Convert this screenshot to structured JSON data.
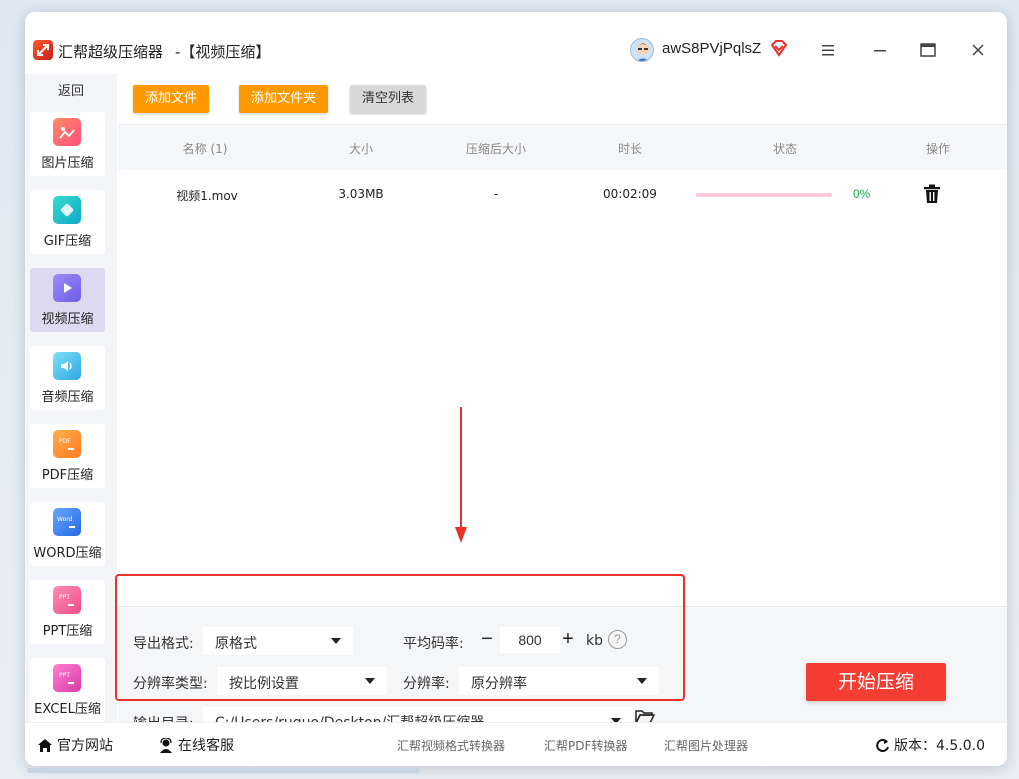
{
  "app": {
    "title": "汇帮超级压缩器",
    "page_tag": "-【视频压缩】",
    "username": "awS8PVjPqlsZ"
  },
  "sidebar": {
    "back_label": "返回",
    "items": [
      {
        "label": "图片压缩",
        "icon": "image-compress-icon",
        "color": "#ff5f78"
      },
      {
        "label": "GIF压缩",
        "icon": "gif-compress-icon",
        "color": "#17c3c9"
      },
      {
        "label": "视频压缩",
        "icon": "video-compress-icon",
        "color": "#7c6ef2",
        "active": true
      },
      {
        "label": "音频压缩",
        "icon": "audio-compress-icon",
        "color": "#3ec6e8"
      },
      {
        "label": "PDF压缩",
        "icon": "pdf-compress-icon",
        "color": "#ff8c2a"
      },
      {
        "label": "WORD压缩",
        "icon": "word-compress-icon",
        "color": "#2f7de8"
      },
      {
        "label": "PPT压缩",
        "icon": "ppt-compress-icon",
        "color": "#f0608f"
      },
      {
        "label": "EXCEL压缩",
        "icon": "excel-compress-icon",
        "color": "#e64ea8"
      }
    ]
  },
  "toolbar": {
    "add_file": "添加文件",
    "add_folder": "添加文件夹",
    "clear_list": "清空列表"
  },
  "table": {
    "headers": {
      "name": "名称 (1)",
      "size": "大小",
      "compressed_size": "压缩后大小",
      "duration": "时长",
      "status": "状态",
      "action": "操作"
    },
    "rows": [
      {
        "name": "视频1.mov",
        "size": "3.03MB",
        "compressed_size": "-",
        "duration": "00:02:09",
        "progress": 0,
        "progress_text": "0%"
      }
    ]
  },
  "settings": {
    "format_label": "导出格式:",
    "format_value": "原格式",
    "bitrate_label": "平均码率:",
    "bitrate_value": "800",
    "bitrate_unit": "kb",
    "minus": "−",
    "plus": "+",
    "help": "?",
    "res_type_label": "分辨率类型:",
    "res_type_value": "按比例设置",
    "res_label": "分辨率:",
    "res_value": "原分辨率",
    "output_label": "输出目录:",
    "output_path": "C:/Users/ruguo/Desktop/汇帮超级压缩器",
    "start_button": "开始压缩"
  },
  "statusbar": {
    "website": "官方网站",
    "support": "在线客服",
    "links": [
      "汇帮视频格式转换器",
      "汇帮PDF转换器",
      "汇帮图片处理器"
    ],
    "version_label": "版本：",
    "version": "4.5.0.0"
  },
  "colors": {
    "accent_orange": "#ff9900",
    "start_red": "#f63d33",
    "progress_pink": "#ffc9d6",
    "progress_text_green": "#23a34f",
    "annotation_red": "#e8322b",
    "active_nav": "#ddd9f1"
  }
}
